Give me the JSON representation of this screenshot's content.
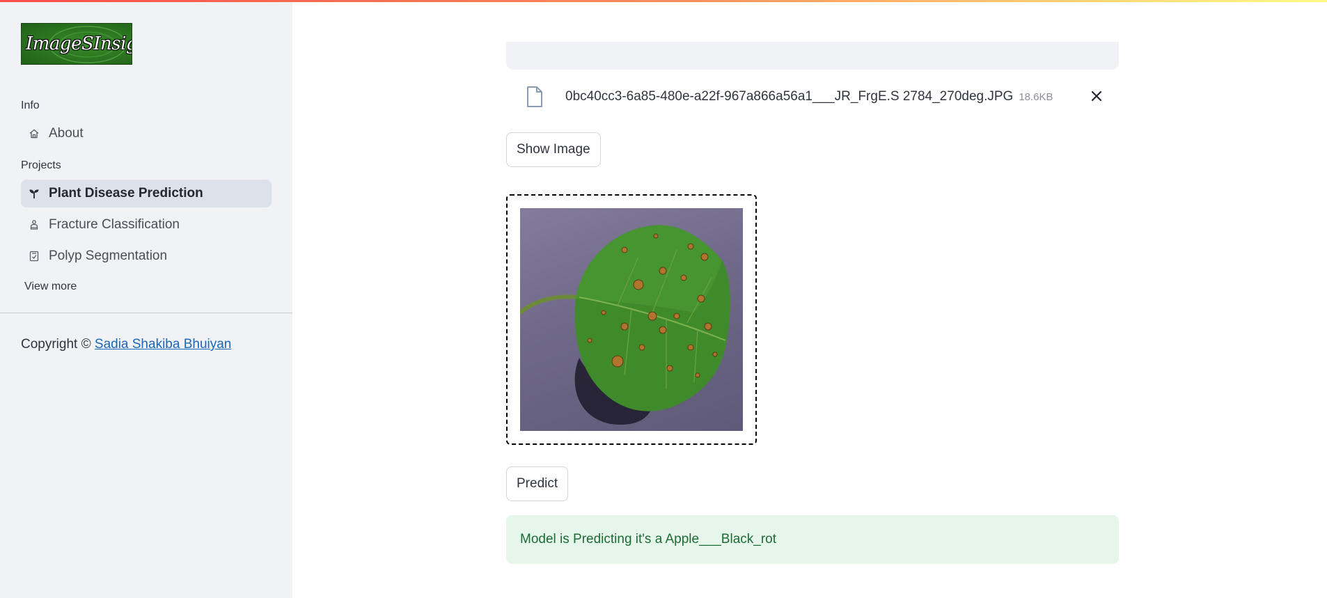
{
  "sidebar": {
    "logo_text": "ImageSInsight",
    "sections": {
      "info": "Info",
      "projects": "Projects"
    },
    "items": [
      {
        "label": "About",
        "icon": "home-icon"
      },
      {
        "label": "Plant Disease Prediction",
        "icon": "plant-icon",
        "active": true
      },
      {
        "label": "Fracture Classification",
        "icon": "person-icon"
      },
      {
        "label": "Polyp Segmentation",
        "icon": "document-icon"
      }
    ],
    "view_more": "View more",
    "copyright_prefix": "Copyright ©",
    "copyright_author": "Sadia Shakiba Bhuiyan"
  },
  "main": {
    "file": {
      "name": "0bc40cc3-6a85-480e-a22f-967a866a56a1___JR_FrgE.S 2784_270deg.JPG",
      "size": "18.6KB"
    },
    "show_image_label": "Show Image",
    "predict_label": "Predict",
    "result_text": "Model is Predicting it's a Apple___Black_rot"
  },
  "colors": {
    "sidebar_bg": "#f0f2f6",
    "active_item_bg": "#dde1ea",
    "link": "#1a66b8",
    "success_bg": "#e6f6ea",
    "success_text": "#1d6b34"
  }
}
